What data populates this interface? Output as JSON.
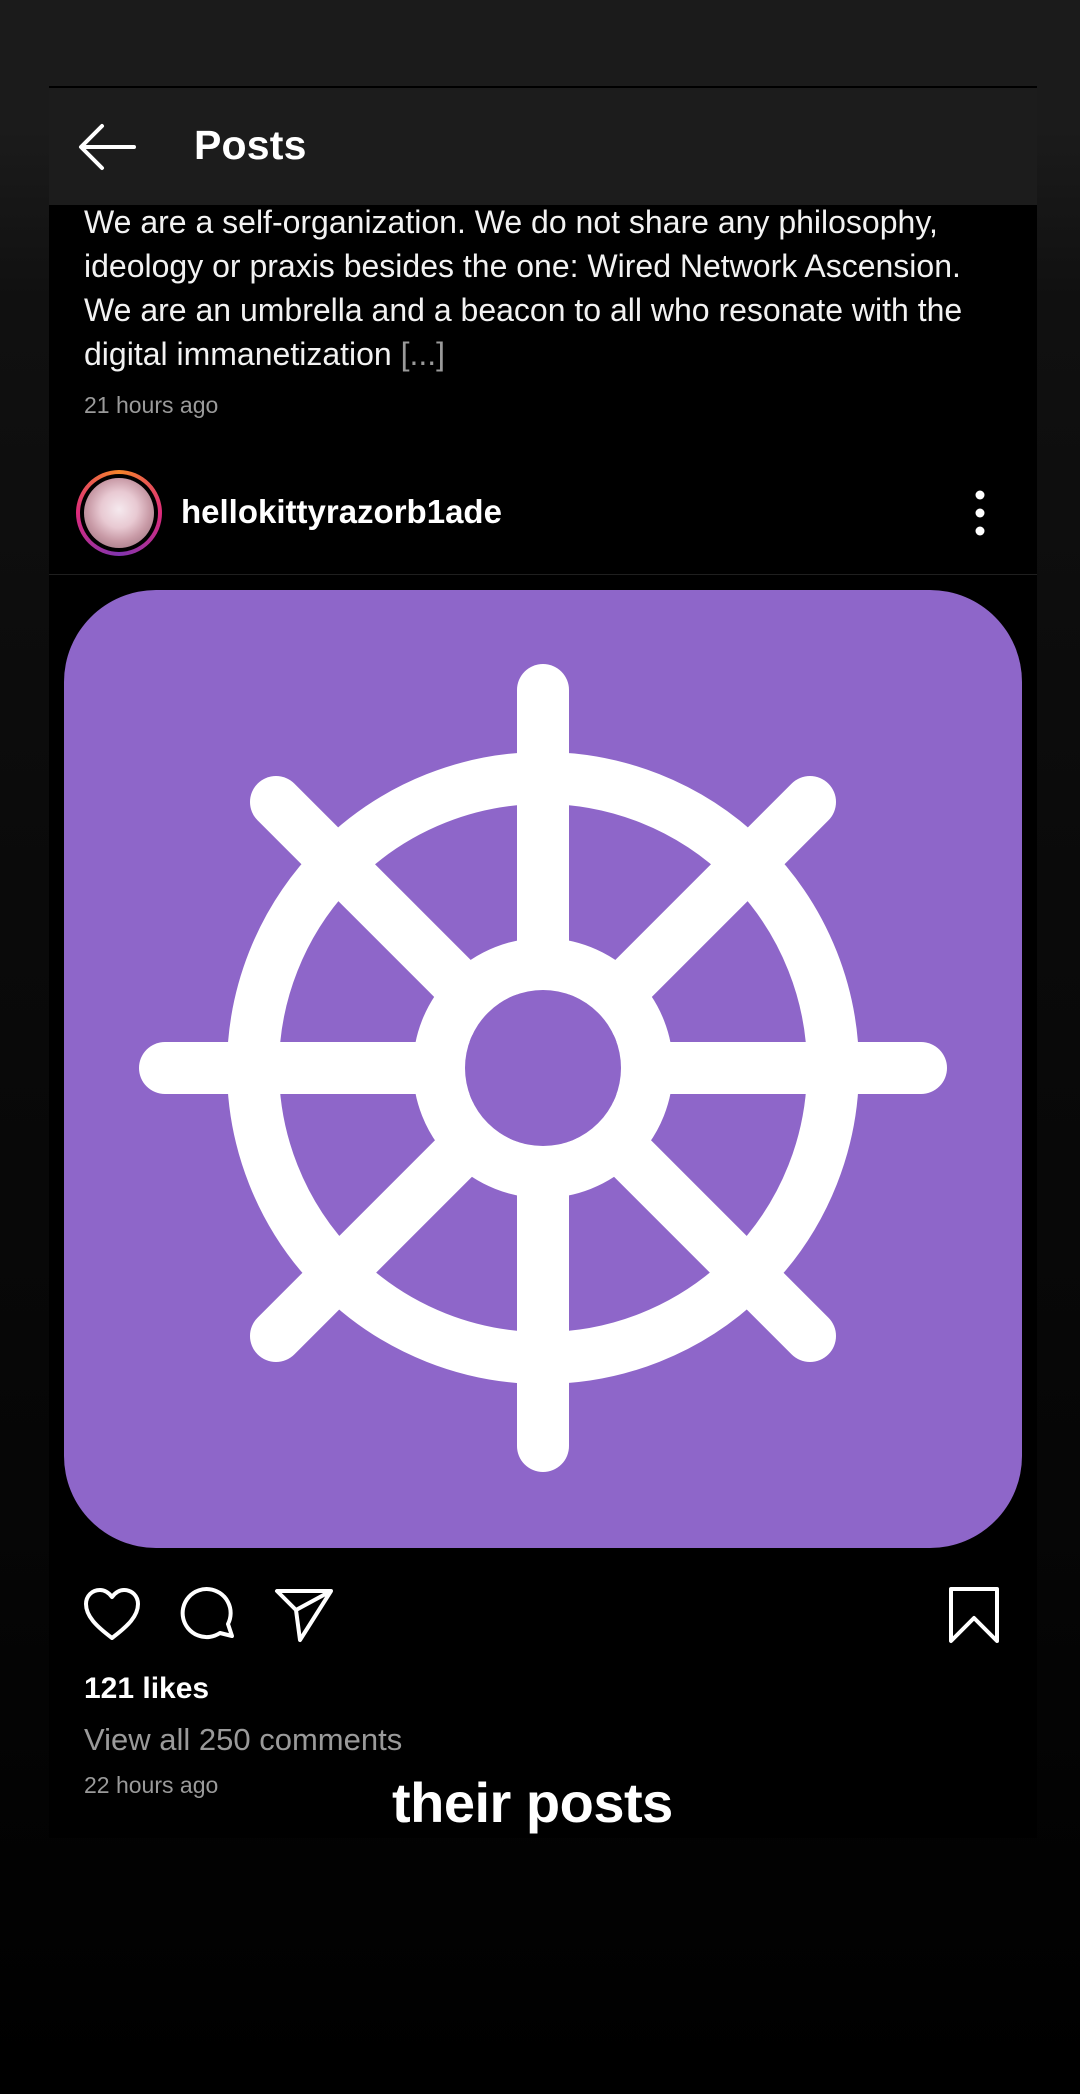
{
  "header": {
    "title": "Posts",
    "back_icon": "arrow-left-icon"
  },
  "previous_post": {
    "caption": "We are a self-organization. We do not share any philosophy, ideology or praxis besides the one: Wired Network Ascension. We are an umbrella and a beacon to all who resonate with the digital immanetization",
    "caption_more": "[...]",
    "timestamp": "21 hours ago"
  },
  "post": {
    "username": "hellokittyrazorb1ade",
    "image_icon": "dharma-wheel-icon",
    "image_bg_color": "#8e66c9",
    "likes": "121 likes",
    "view_comments": "View all 250 comments",
    "timestamp": "22 hours ago",
    "actions": {
      "like_icon": "heart-icon",
      "comment_icon": "comment-icon",
      "share_icon": "send-icon",
      "save_icon": "bookmark-icon"
    }
  },
  "overlay": {
    "caption": "their posts"
  }
}
